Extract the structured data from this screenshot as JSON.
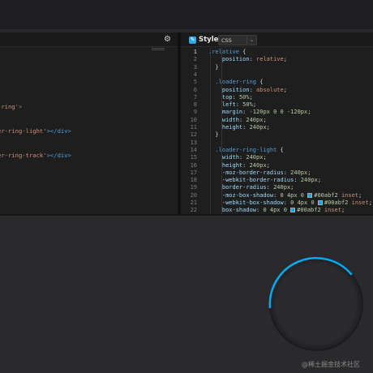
{
  "html_panel": {
    "lines": [
      {
        "prefix": "-ring'",
        "suffix": ">"
      },
      {
        "prefix": "er-ring-light'",
        "suffix": "></div>"
      },
      {
        "prefix": "er-ring-track'",
        "suffix": "></div>"
      }
    ]
  },
  "css_panel": {
    "title": "Style",
    "language": "CSS",
    "lines": [
      {
        "n": "1",
        "tokens": [
          {
            "t": ".relative",
            "c": "sel"
          },
          {
            "t": " {",
            "c": "p"
          }
        ]
      },
      {
        "n": "2",
        "tokens": [
          {
            "t": "    position",
            "c": "prop"
          },
          {
            "t": ": ",
            "c": "p"
          },
          {
            "t": "relative",
            "c": "val"
          },
          {
            "t": ";",
            "c": "p"
          }
        ]
      },
      {
        "n": "3",
        "tokens": [
          {
            "t": "  }",
            "c": "p"
          }
        ]
      },
      {
        "n": "4",
        "tokens": []
      },
      {
        "n": "5",
        "tokens": [
          {
            "t": "  .loader-ring",
            "c": "sel"
          },
          {
            "t": " {",
            "c": "p"
          }
        ]
      },
      {
        "n": "6",
        "tokens": [
          {
            "t": "    position",
            "c": "prop"
          },
          {
            "t": ": ",
            "c": "p"
          },
          {
            "t": "absolute",
            "c": "val"
          },
          {
            "t": ";",
            "c": "p"
          }
        ]
      },
      {
        "n": "7",
        "tokens": [
          {
            "t": "    top",
            "c": "prop"
          },
          {
            "t": ": ",
            "c": "p"
          },
          {
            "t": "50%",
            "c": "num"
          },
          {
            "t": ";",
            "c": "p"
          }
        ]
      },
      {
        "n": "8",
        "tokens": [
          {
            "t": "    left",
            "c": "prop"
          },
          {
            "t": ": ",
            "c": "p"
          },
          {
            "t": "50%",
            "c": "num"
          },
          {
            "t": ";",
            "c": "p"
          }
        ]
      },
      {
        "n": "9",
        "tokens": [
          {
            "t": "    margin",
            "c": "prop"
          },
          {
            "t": ": ",
            "c": "p"
          },
          {
            "t": "-120px 0 0 -120px",
            "c": "num"
          },
          {
            "t": ";",
            "c": "p"
          }
        ]
      },
      {
        "n": "10",
        "tokens": [
          {
            "t": "    width",
            "c": "prop"
          },
          {
            "t": ": ",
            "c": "p"
          },
          {
            "t": "240px",
            "c": "num"
          },
          {
            "t": ";",
            "c": "p"
          }
        ]
      },
      {
        "n": "11",
        "tokens": [
          {
            "t": "    height",
            "c": "prop"
          },
          {
            "t": ": ",
            "c": "p"
          },
          {
            "t": "240px",
            "c": "num"
          },
          {
            "t": ";",
            "c": "p"
          }
        ]
      },
      {
        "n": "12",
        "tokens": [
          {
            "t": "  }",
            "c": "p"
          }
        ]
      },
      {
        "n": "13",
        "tokens": []
      },
      {
        "n": "14",
        "tokens": [
          {
            "t": "  .loader-ring-light",
            "c": "sel"
          },
          {
            "t": " {",
            "c": "p"
          }
        ]
      },
      {
        "n": "15",
        "tokens": [
          {
            "t": "    width",
            "c": "prop"
          },
          {
            "t": ": ",
            "c": "p"
          },
          {
            "t": "240px",
            "c": "num"
          },
          {
            "t": ";",
            "c": "p"
          }
        ]
      },
      {
        "n": "16",
        "tokens": [
          {
            "t": "    height",
            "c": "prop"
          },
          {
            "t": ": ",
            "c": "p"
          },
          {
            "t": "240px",
            "c": "num"
          },
          {
            "t": ";",
            "c": "p"
          }
        ]
      },
      {
        "n": "17",
        "tokens": [
          {
            "t": "    -moz-border-radius",
            "c": "prop"
          },
          {
            "t": ": ",
            "c": "p"
          },
          {
            "t": "240px",
            "c": "num"
          },
          {
            "t": ";",
            "c": "p"
          }
        ]
      },
      {
        "n": "18",
        "tokens": [
          {
            "t": "    -webkit-border-radius",
            "c": "prop"
          },
          {
            "t": ": ",
            "c": "p"
          },
          {
            "t": "240px",
            "c": "num"
          },
          {
            "t": ";",
            "c": "p"
          }
        ]
      },
      {
        "n": "19",
        "tokens": [
          {
            "t": "    border-radius",
            "c": "prop"
          },
          {
            "t": ": ",
            "c": "p"
          },
          {
            "t": "240px",
            "c": "num"
          },
          {
            "t": ";",
            "c": "p"
          }
        ]
      },
      {
        "n": "20",
        "tokens": [
          {
            "t": "    -moz-box-shadow",
            "c": "prop"
          },
          {
            "t": ": ",
            "c": "p"
          },
          {
            "t": "0 4px 0 ",
            "c": "num"
          },
          {
            "sw": "#00abf2"
          },
          {
            "t": "#00abf2",
            "c": "num"
          },
          {
            "t": " inset",
            "c": "val"
          },
          {
            "t": ";",
            "c": "p"
          }
        ]
      },
      {
        "n": "21",
        "tokens": [
          {
            "t": "    -webkit-box-shadow",
            "c": "prop"
          },
          {
            "t": ": ",
            "c": "p"
          },
          {
            "t": "0 4px 0 ",
            "c": "num"
          },
          {
            "sw": "#00abf2"
          },
          {
            "t": "#00abf2",
            "c": "num"
          },
          {
            "t": " inset",
            "c": "val"
          },
          {
            "t": ";",
            "c": "p"
          }
        ]
      },
      {
        "n": "22",
        "tokens": [
          {
            "t": "    box-shadow",
            "c": "prop"
          },
          {
            "t": ": ",
            "c": "p"
          },
          {
            "t": "0 4px 0 ",
            "c": "num"
          },
          {
            "sw": "#00abf2"
          },
          {
            "t": "#00abf2",
            "c": "num"
          },
          {
            "t": " inset",
            "c": "val"
          },
          {
            "t": ";",
            "c": "p"
          }
        ]
      }
    ]
  },
  "preview": {
    "ring_color": "#00abf2",
    "watermark": "@稀土掘金技术社区"
  }
}
